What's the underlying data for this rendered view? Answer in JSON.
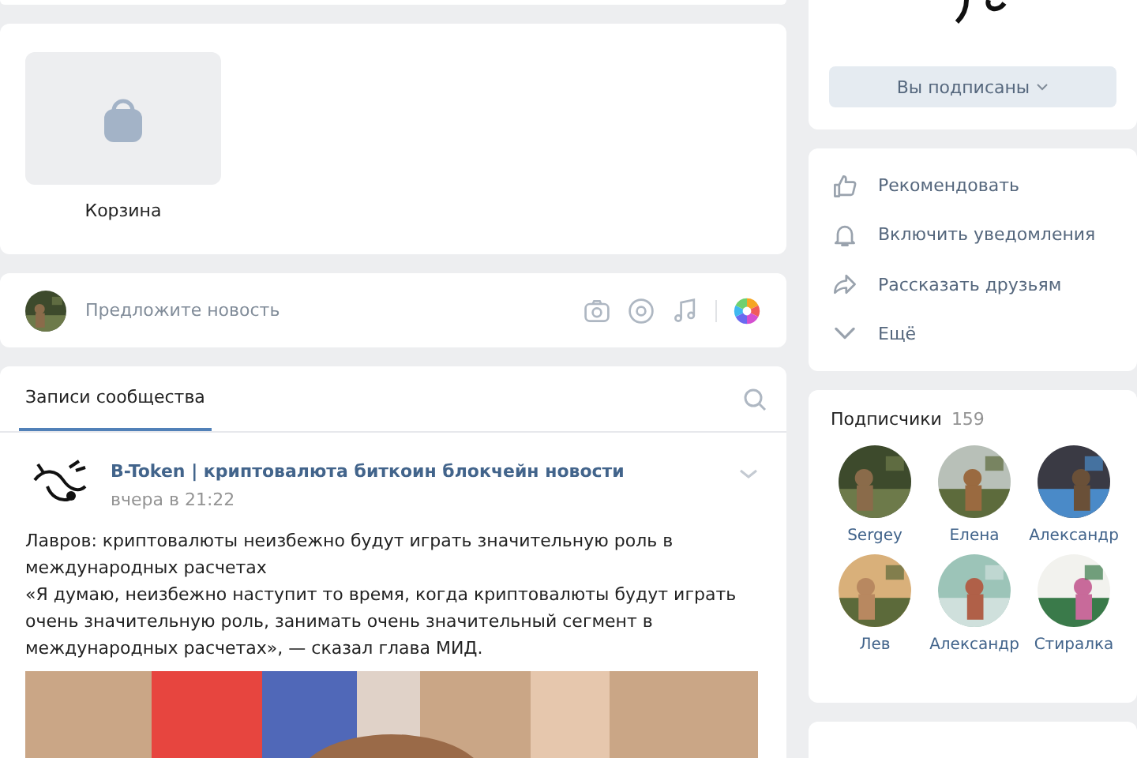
{
  "products": [
    {
      "name": "Корзина"
    }
  ],
  "suggest": {
    "placeholder": "Предложите новость"
  },
  "tabs": [
    {
      "label": "Записи сообщества",
      "selected": true
    }
  ],
  "post": {
    "author": "B-Token | криптовалюта биткоин блокчейн новости",
    "time": "вчера в 21:22",
    "paragraphs": [
      "Лавров: криптовалюты неизбежно будут играть значительную роль в международных расчетах",
      "«Я думаю, неизбежно наступит то время, когда криптовалюты будут играть очень значительную роль, занимать очень значительный сегмент в международных расчетах», — сказал глава МИД."
    ]
  },
  "subscribe_button": {
    "label": "Вы подписаны"
  },
  "actions": [
    {
      "kind": "like",
      "label": "Рекомендовать"
    },
    {
      "kind": "bell",
      "label": "Включить уведомления"
    },
    {
      "kind": "share",
      "label": "Рассказать друзьям"
    },
    {
      "kind": "more",
      "label": "Ещё"
    }
  ],
  "followers": {
    "title": "Подписчики",
    "count": "159",
    "items": [
      {
        "name": "Sergey"
      },
      {
        "name": "Елена"
      },
      {
        "name": "Александр"
      },
      {
        "name": "Лев"
      },
      {
        "name": "Александр"
      },
      {
        "name": "Стиралка"
      }
    ]
  }
}
